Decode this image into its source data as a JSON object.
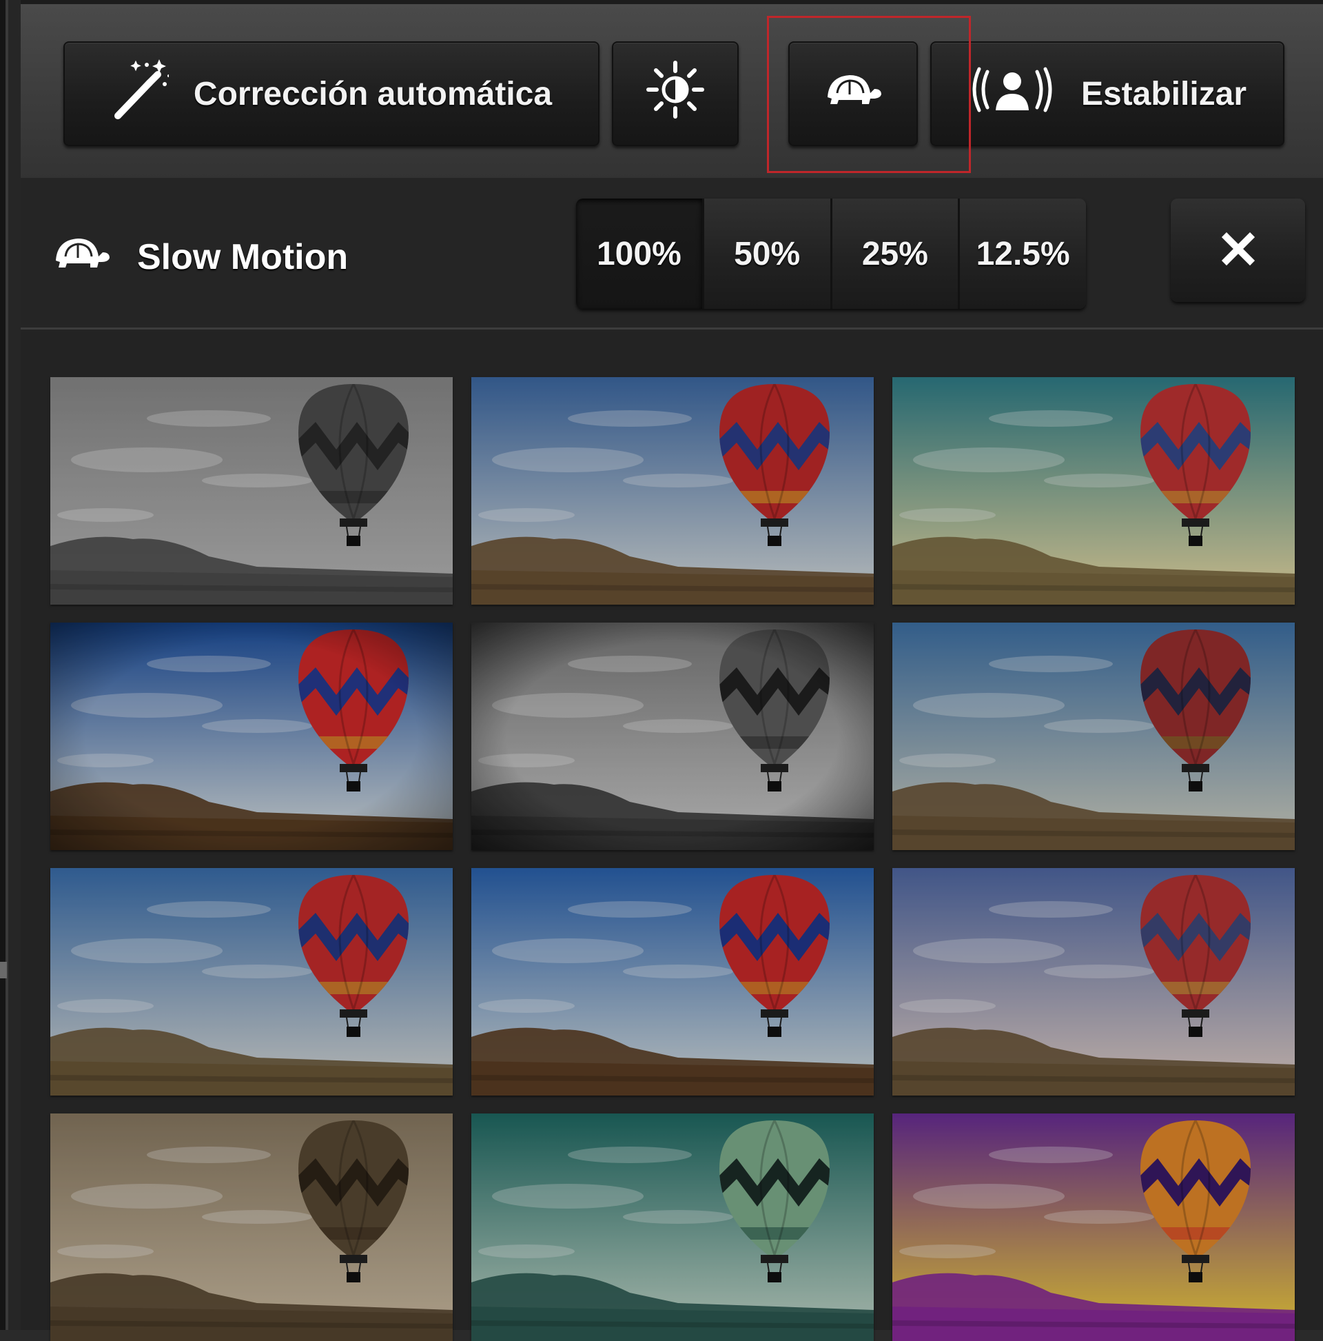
{
  "toolbar": {
    "auto_correct_label": "Corrección automática",
    "stabilize_label": "Estabilizar",
    "brightness_icon": "brightness-icon",
    "slowmo_icon": "turtle-icon",
    "stabilize_icon": "person-shake-icon",
    "auto_correct_icon": "magic-wand-icon"
  },
  "panel": {
    "title": "Slow Motion",
    "title_icon": "turtle-icon",
    "speeds": [
      "100%",
      "50%",
      "25%",
      "12.5%"
    ],
    "selected_speed": "100%",
    "close_icon": "close-icon"
  },
  "filters": [
    {
      "sky_top": "#8a8a8a",
      "sky_bottom": "#b5b5b5",
      "ground": "#4e4e4e",
      "balloon": "#4d4d4d",
      "stripe": "#2b2b2b",
      "band": "#3a3a3a",
      "vignette": 0.0
    },
    {
      "sky_top": "#3d6aa6",
      "sky_bottom": "#c9d3da",
      "ground": "#6b5234",
      "balloon": "#c32a2a",
      "stripe": "#2c3d8a",
      "band": "#d57a2a",
      "vignette": 0.0
    },
    {
      "sky_top": "#2f7f8a",
      "sky_bottom": "#d9d5a4",
      "ground": "#7a6840",
      "balloon": "#c23434",
      "stripe": "#364a8d",
      "band": "#cf7a34",
      "vignette": 0.0
    },
    {
      "sky_top": "#1b4fa0",
      "sky_bottom": "#c8d4de",
      "ground": "#5a3d22",
      "balloon": "#d42a2a",
      "stripe": "#283b93",
      "band": "#d8782a",
      "vignette": 0.55
    },
    {
      "sky_top": "#7b7b7b",
      "sky_bottom": "#c3c3c3",
      "ground": "#3d3d3d",
      "balloon": "#5f5f5f",
      "stripe": "#222",
      "band": "#444",
      "vignette": 0.75
    },
    {
      "sky_top": "#3e72a8",
      "sky_bottom": "#c3c9c2",
      "ground": "#6b5538",
      "balloon": "#9c2f2f",
      "stripe": "#2a2a4a",
      "band": "#8a5a2a",
      "vignette": 0.0
    },
    {
      "sky_top": "#3a6fae",
      "sky_bottom": "#c9d1d6",
      "ground": "#6c5838",
      "balloon": "#c92c2c",
      "stripe": "#253a88",
      "band": "#d17a2c",
      "vignette": 0.0
    },
    {
      "sky_top": "#2a63b0",
      "sky_bottom": "#c5d3dd",
      "ground": "#5c3e24",
      "balloon": "#cc2a2a",
      "stripe": "#22378e",
      "band": "#d5752a",
      "vignette": 0.0
    },
    {
      "sky_top": "#5069a6",
      "sky_bottom": "#d4c6c6",
      "ground": "#6a5538",
      "balloon": "#b83434",
      "stripe": "#40497c",
      "band": "#c27a3a",
      "vignette": 0.0
    },
    {
      "sky_top": "#8a7a62",
      "sky_bottom": "#c8b89e",
      "ground": "#574630",
      "balloon": "#5a4a34",
      "stripe": "#2e2418",
      "band": "#4a3a28",
      "vignette": 0.0
    },
    {
      "sky_top": "#1e6a64",
      "sky_bottom": "#b4cfc2",
      "ground": "#2c5a52",
      "balloon": "#7fb08e",
      "stripe": "#1c2c28",
      "band": "#4a7a66",
      "vignette": 0.0
    },
    {
      "sky_top": "#6a2d98",
      "sky_bottom": "#e8c248",
      "ground": "#8a2a9a",
      "balloon": "#e78a2a",
      "stripe": "#3a1a6a",
      "band": "#e05a2a",
      "vignette": 0.0
    }
  ],
  "colors": {
    "highlight": "#c0262a",
    "button_bg": "#1c1c1c",
    "panel_bg": "#232323"
  }
}
